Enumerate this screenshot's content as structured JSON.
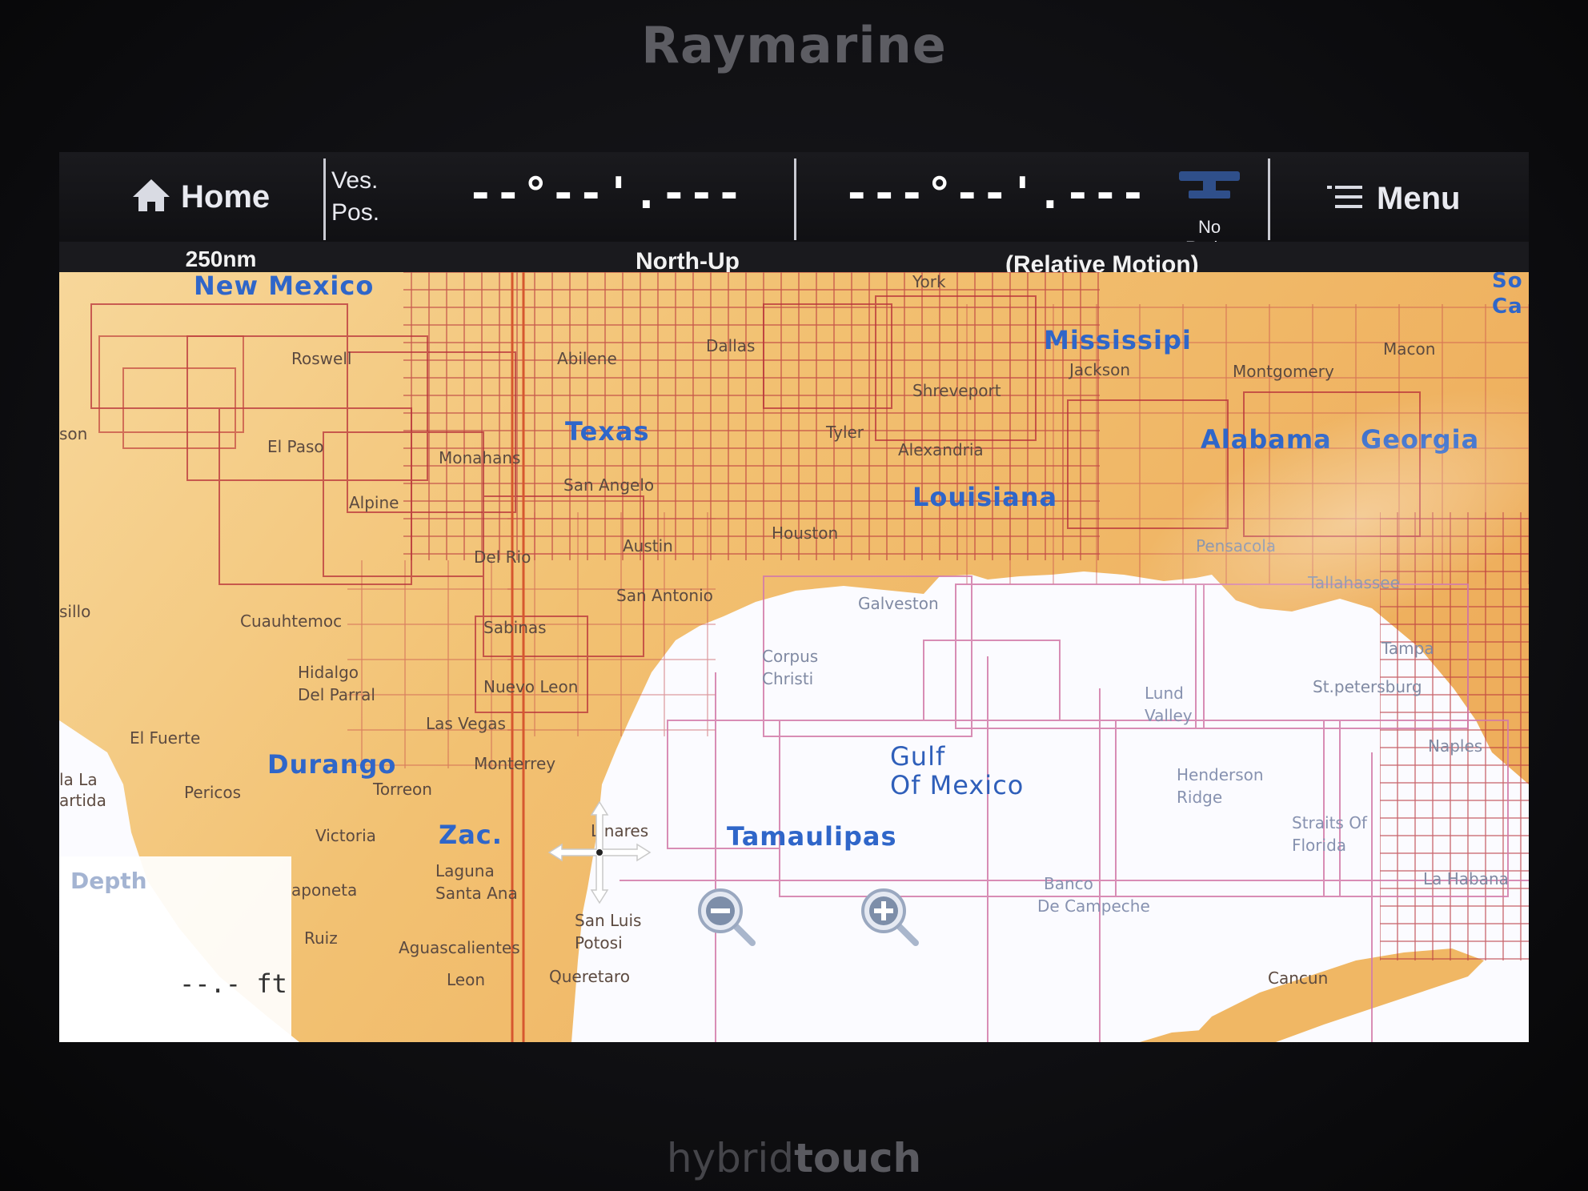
{
  "device": {
    "brand": "Raymarine",
    "model_prefix": "hybrid",
    "model_suffix": "touch"
  },
  "topbar": {
    "home_label": "Home",
    "vespos_line1": "Ves.",
    "vespos_line2": "Pos.",
    "latitude": "--°--'.---",
    "longitude": "---°--'.---",
    "radar_label": "No Radar",
    "menu_label": "Menu"
  },
  "status": {
    "scale": "250nm",
    "orientation": "North-Up",
    "motion": "(Relative Motion)"
  },
  "map": {
    "regions": {
      "new_mexico": "New Mexico",
      "texas": "Texas",
      "mississippi": "Mississipi",
      "louisiana": "Louisiana",
      "alabama": "Alabama",
      "georgia": "Georgia",
      "durango": "Durango",
      "zac": "Zac.",
      "tamaulipas": "Tamaulipas"
    },
    "sea": {
      "line1": "Gulf",
      "line2": "Of Mexico"
    },
    "cities": {
      "roswell": "Roswell",
      "abilene": "Abilene",
      "dallas": "Dallas",
      "shreveport": "Shreveport",
      "jackson": "Jackson",
      "el_paso": "El Paso",
      "monahans": "Monahans",
      "tyler": "Tyler",
      "alexandria": "Alexandria",
      "san_angelo": "San Angelo",
      "alpine": "Alpine",
      "houston": "Houston",
      "del_rio": "Del Rio",
      "austin": "Austin",
      "san_antonio": "San Antonio",
      "galveston": "Galveston",
      "pensacola": "Pensacola",
      "tallahassee": "Tallahassee",
      "cuauhtemoc": "Cuauhtemoc",
      "sabinas": "Sabinas",
      "corpus1": "Corpus",
      "corpus2": "Christi",
      "tampa": "Tampa",
      "hidalgo1": "Hidalgo",
      "hidalgo2": "Del Parral",
      "nuevo_leon": "Nuevo Leon",
      "st_petersburg": "St.petersburg",
      "el_fuerte": "El Fuerte",
      "las_vegas": "Las Vegas",
      "naples": "Naples",
      "monterrey": "Monterrey",
      "pericos": "Pericos",
      "torreon": "Torreon",
      "victoria": "Victoria",
      "linares": "Linares",
      "laguna1": "Laguna",
      "laguna2": "Santa Ana",
      "aponeta": "aponeta",
      "san_luis1": "San Luis",
      "san_luis2": "Potosi",
      "ruiz": "Ruiz",
      "aguascalientes": "Aguascalientes",
      "leon": "Leon",
      "queretaro": "Queretaro",
      "la_habana": "La Habana",
      "cancun": "Cancun",
      "macon": "Macon",
      "montgomery": "Montgomery",
      "york": "York",
      "son": "son",
      "sillo": "sillo",
      "la_la1": "la La",
      "la_la2": "artida"
    },
    "features": {
      "lund1": "Lund",
      "lund2": "Valley",
      "henderson1": "Henderson",
      "henderson2": "Ridge",
      "straits1": "Straits Of",
      "straits2": "Florida",
      "banco1": "Banco",
      "banco2": "De Campeche"
    },
    "edge_labels": {
      "sc1": "So",
      "sc2": "Ca"
    }
  },
  "depth": {
    "title": "Depth",
    "value": "--.- ft"
  },
  "icons": {
    "home": "home-icon",
    "radar": "radar-icon",
    "menu": "menu-icon",
    "pan": "pan-arrows-icon",
    "zoom_out": "zoom-out-icon",
    "zoom_in": "zoom-in-icon"
  },
  "colors": {
    "land_warm": "#f0b764",
    "land_pale": "#f7d79a",
    "water": "#fbfbff",
    "grid_red": "#b8323a",
    "grid_pink": "#d27aa9",
    "region_text": "#2f66c9"
  }
}
